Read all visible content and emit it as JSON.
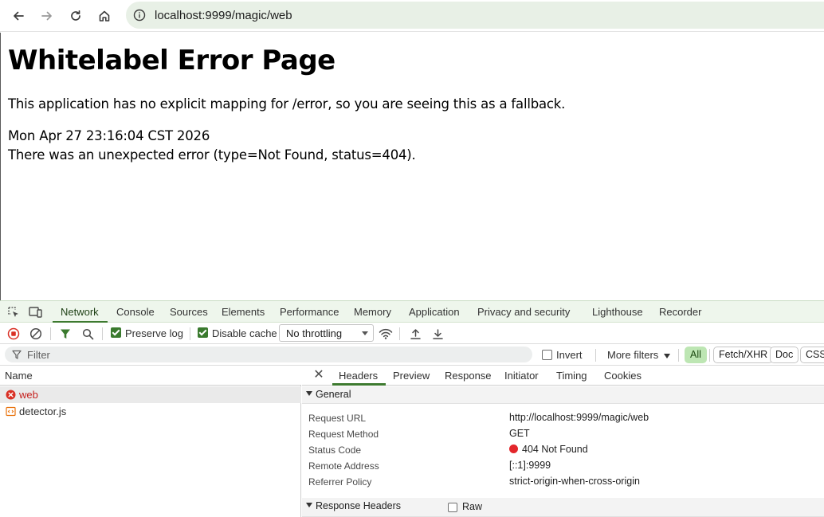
{
  "browser": {
    "url": "localhost:9999/magic/web"
  },
  "page": {
    "title": "Whitelabel Error Page",
    "message": "This application has no explicit mapping for /error, so you are seeing this as a fallback.",
    "timestamp": "Mon Apr 27 23:16:04 CST 2026",
    "error_line": "There was an unexpected error (type=Not Found, status=404)."
  },
  "devtools": {
    "tabs": [
      "Network",
      "Console",
      "Sources",
      "Elements",
      "Performance",
      "Memory",
      "Application",
      "Privacy and security",
      "Lighthouse",
      "Recorder"
    ],
    "active_tab": "Network",
    "toolbar": {
      "preserve_log_label": "Preserve log",
      "preserve_log_checked": true,
      "disable_cache_label": "Disable cache",
      "disable_cache_checked": true,
      "throttling_value": "No throttling"
    },
    "filter": {
      "placeholder": "Filter",
      "invert_label": "Invert",
      "more_filters_label": "More filters",
      "type_chips": [
        "All",
        "Fetch/XHR",
        "Doc",
        "CSS"
      ],
      "active_chip": "All"
    },
    "requests": {
      "column_header": "Name",
      "items": [
        {
          "name": "web",
          "status": "error",
          "selected": true
        },
        {
          "name": "detector.js",
          "status": "ok",
          "selected": false
        }
      ]
    },
    "details": {
      "tabs": [
        "Headers",
        "Preview",
        "Response",
        "Initiator",
        "Timing",
        "Cookies"
      ],
      "active_tab": "Headers",
      "general_title": "General",
      "general": [
        {
          "key": "Request URL",
          "value": "http://localhost:9999/magic/web"
        },
        {
          "key": "Request Method",
          "value": "GET"
        },
        {
          "key": "Status Code",
          "value": "404 Not Found"
        },
        {
          "key": "Remote Address",
          "value": "[::1]:9999"
        },
        {
          "key": "Referrer Policy",
          "value": "strict-origin-when-cross-origin"
        }
      ],
      "response_headers_title": "Response Headers",
      "raw_label": "Raw"
    }
  },
  "colors": {
    "accent": "#3d7a2f",
    "error": "#c5221f",
    "status_dot": "#e3262b"
  }
}
